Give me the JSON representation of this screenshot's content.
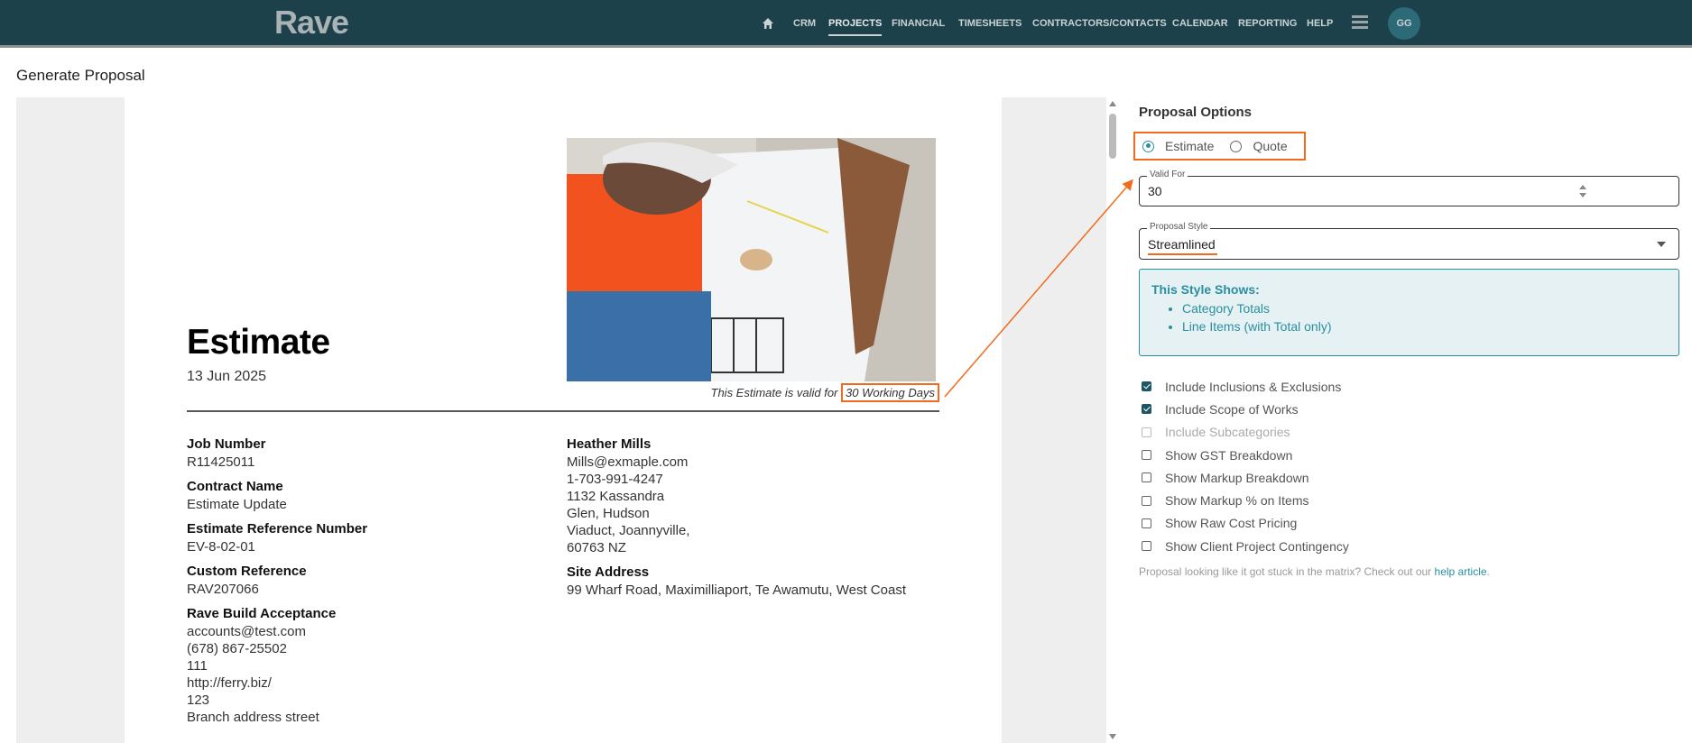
{
  "nav": {
    "logo": "Rave",
    "items": [
      "CRM",
      "PROJECTS",
      "FINANCIAL",
      "TIMESHEETS",
      "CONTRACTORS/CONTACTS",
      "CALENDAR",
      "REPORTING",
      "HELP"
    ],
    "active": "PROJECTS",
    "avatar": "GG"
  },
  "page_title": "Generate Proposal",
  "document": {
    "title": "Estimate",
    "date": "13 Jun 2025",
    "validity_prefix": "This Estimate is valid for",
    "validity_value": "30 Working Days",
    "left": [
      {
        "label": "Job Number",
        "value": "R11425011"
      },
      {
        "label": "Contract Name",
        "value": "Estimate Update"
      },
      {
        "label": "Estimate Reference Number",
        "value": "EV-8-02-01"
      },
      {
        "label": "Custom Reference",
        "value": "RAV207066"
      },
      {
        "label": "Rave Build Acceptance",
        "lines": [
          "accounts@test.com",
          "(678) 867-25502",
          "111",
          "http://ferry.biz/",
          "123",
          "Branch address street"
        ]
      }
    ],
    "client": {
      "name": "Heather Mills",
      "lines": [
        "Mills@exmaple.com",
        "1-703-991-4247",
        "1132 Kassandra",
        "Glen, Hudson",
        "Viaduct, Joannyville,",
        "60763 NZ"
      ]
    },
    "site": {
      "label": "Site Address",
      "value": "99 Wharf Road, Maximilliaport, Te Awamutu, West Coast"
    }
  },
  "options": {
    "title": "Proposal Options",
    "type_options": [
      "Estimate",
      "Quote"
    ],
    "selected_type": "Estimate",
    "valid_for": {
      "label": "Valid For",
      "value": "30"
    },
    "style": {
      "label": "Proposal Style",
      "value": "Streamlined"
    },
    "info": {
      "heading": "This Style Shows:",
      "items": [
        "Category Totals",
        "Line Items (with Total only)"
      ]
    },
    "checkboxes": [
      {
        "label": "Include Inclusions & Exclusions",
        "checked": true
      },
      {
        "label": "Include Scope of Works",
        "checked": true
      },
      {
        "label": "Include Subcategories",
        "checked": false,
        "disabled": true
      },
      {
        "label": "Show GST Breakdown",
        "checked": false
      },
      {
        "label": "Show Markup Breakdown",
        "checked": false
      },
      {
        "label": "Show Markup % on Items",
        "checked": false
      },
      {
        "label": "Show Raw Cost Pricing",
        "checked": false
      },
      {
        "label": "Show Client Project Contingency",
        "checked": false
      }
    ],
    "help_text": "Proposal looking like it got stuck in the matrix? Check out our",
    "help_link": "help article",
    "help_end": "."
  },
  "colors": {
    "nav": "#1d414a",
    "accent": "#2a8fa0",
    "annotation": "#f26a1b"
  }
}
